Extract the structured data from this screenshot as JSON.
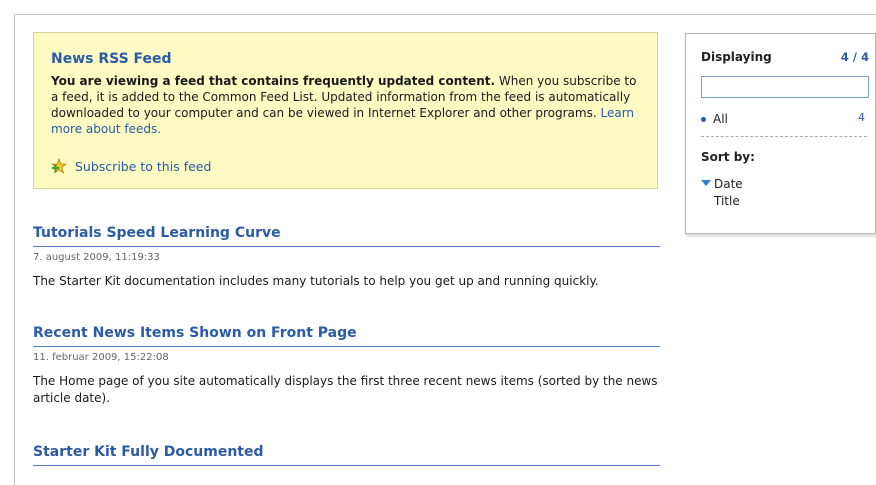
{
  "feed_info": {
    "title": "News RSS Feed",
    "bold_text": "You are viewing a feed that contains frequently updated content.",
    "text": " When you subscribe to a feed, it is added to the Common Feed List. Updated information from the feed is automatically downloaded to your computer and can be viewed in Internet Explorer and other programs. ",
    "link": "Learn more about feeds.",
    "subscribe": "Subscribe to this feed"
  },
  "articles": [
    {
      "title": "Tutorials Speed Learning Curve",
      "date": "7. august 2009, 11:19:33",
      "body": "The Starter Kit documentation includes many tutorials to help you get up and running quickly."
    },
    {
      "title": "Recent News Items Shown on Front Page",
      "date": "11. februar 2009, 15:22:08",
      "body": "The Home page of you site automatically displays the first three recent news items (sorted by the news article date)."
    },
    {
      "title": "Starter Kit Fully Documented",
      "date": "",
      "body": ""
    }
  ],
  "side_panel": {
    "displaying_label": "Displaying",
    "count": "4 / 4",
    "search_value": "",
    "filter_all": "All",
    "filter_all_count": "4",
    "sort_label": "Sort by:",
    "sort_options": [
      "Date",
      "Title"
    ]
  }
}
